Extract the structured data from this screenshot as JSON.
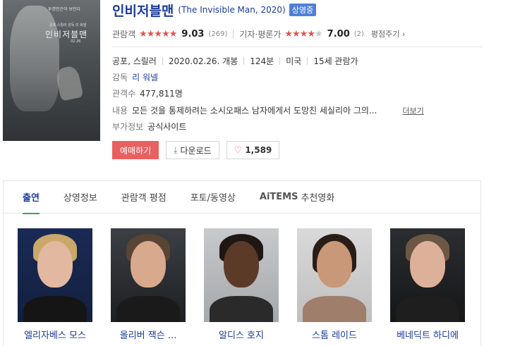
{
  "movie": {
    "title_ko": "인비저블맨",
    "title_en": "(The Invisible Man, 2020)",
    "status_badge": "상영중"
  },
  "poster": {
    "title_text": "인비저블맨",
    "tagline": "투명인간이 보인다",
    "sub_text": "공포 스릴러 감독 리 워넬",
    "date_text": "02.26"
  },
  "ratings": {
    "audience_label": "관람객",
    "audience_score": "9.03",
    "audience_count": "(269)",
    "audience_stars": 4.5,
    "critic_label": "기자·평론가",
    "critic_score": "7.00",
    "critic_count": "(2)",
    "critic_stars": 3.5,
    "rate_link": "평점주기"
  },
  "details": {
    "genre": "공포, 스릴러",
    "release": "2020.02.26. 개봉",
    "runtime": "124분",
    "country": "미국",
    "age_rating": "15세 관람가",
    "director_label": "감독",
    "director": "리 워넬",
    "audience_count_label": "관객수",
    "audience_count": "477,811명",
    "synopsis_label": "내용",
    "synopsis": "모든 것을 통제하려는 소시오패스 남자에게서 도망친 세실리아 그의...",
    "more_link": "더보기",
    "extra_label": "부가정보",
    "official_site": "공식사이트"
  },
  "actions": {
    "reserve": "예매하기",
    "download": "다운로드",
    "like_count": "1,589"
  },
  "tabs": [
    {
      "label": "출연",
      "active": true
    },
    {
      "label": "상영정보"
    },
    {
      "label": "관람객 평점"
    },
    {
      "label": "포토/동영상"
    },
    {
      "label": "추천영화",
      "prefix": "AiTEMS"
    }
  ],
  "cast": [
    {
      "name": "엘리자베스 모스"
    },
    {
      "name": "올리버 잭슨 ..."
    },
    {
      "name": "알디스 호지"
    },
    {
      "name": "스톰 레이드"
    },
    {
      "name": "베네딕트 하디에"
    }
  ],
  "colors": {
    "title_blue": "#1a3a9c",
    "star_red": "#e2544f",
    "badge_blue": "#4f7fda",
    "reserve_red": "#e8605f",
    "tab_green": "#3aa64b"
  }
}
